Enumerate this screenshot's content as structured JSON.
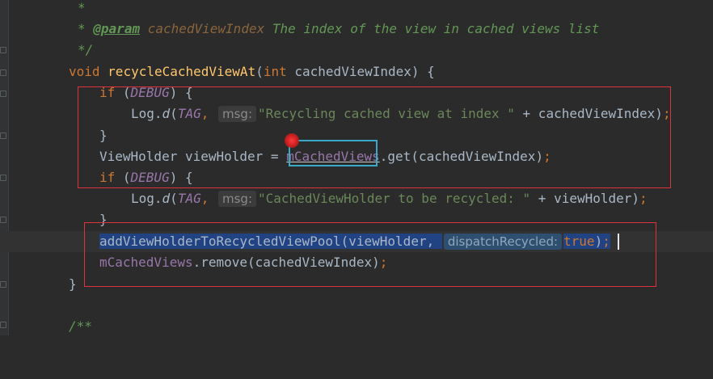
{
  "editor": {
    "lines": {
      "l1": {
        "star": "*"
      },
      "l2": {
        "star": "*",
        "tag": "@param",
        "param": "cachedViewIndex",
        "desc": "The index of the view in cached views list"
      },
      "l3": {
        "end": "*/"
      },
      "l4": {
        "kw_void": "void",
        "method": "recycleCachedViewAt",
        "open": "(",
        "kw_int": "int",
        "param": "cachedViewIndex",
        "close": ") {"
      },
      "l5": {
        "kw_if": "if",
        "open": " (",
        "debug": "DEBUG",
        "close": ") {"
      },
      "l6": {
        "log": "Log.",
        "d": "d",
        "open": "(",
        "tag": "TAG",
        "comma": ",",
        "hint": "msg:",
        "str": "\"Recycling cached view at index \"",
        "rest": " + cachedViewIndex)",
        "semi": ";"
      },
      "l7": {
        "brace": "}"
      },
      "l8": {
        "type": "ViewHolder viewHolder = ",
        "field": "mCachedViews",
        "rest": ".get(cachedViewIndex)",
        "semi": ";"
      },
      "l9": {
        "kw_if": "if",
        "open": " (",
        "debug": "DEBUG",
        "close": ") {"
      },
      "l10": {
        "log": "Log.",
        "d": "d",
        "open": "(",
        "tag": "TAG",
        "comma": ",",
        "hint": "msg:",
        "str": "\"CachedViewHolder to be recycled: \"",
        "rest": " + viewHolder)",
        "semi": ";"
      },
      "l11": {
        "brace": "}"
      },
      "l12": {
        "call": "addViewHolderToRecycledViewPool(viewHolder,",
        "hint": "dispatchRecycled:",
        "kw_true": "true",
        "close": ")",
        "semi": ";"
      },
      "l13": {
        "field": "mCachedViews",
        "rest": ".remove(cachedViewIndex)",
        "semi": ";"
      },
      "l14": {
        "brace": "}"
      },
      "l15": {
        "doc": "/**"
      }
    }
  },
  "colors": {
    "background": "#2b2b2b",
    "keyword": "#cc7832",
    "method": "#ffc66d",
    "field": "#9876aa",
    "string": "#6a8759",
    "comment": "#629755",
    "annotation_box": "#e0323c",
    "focus_box": "#3aa8c8",
    "selection": "#214283"
  }
}
